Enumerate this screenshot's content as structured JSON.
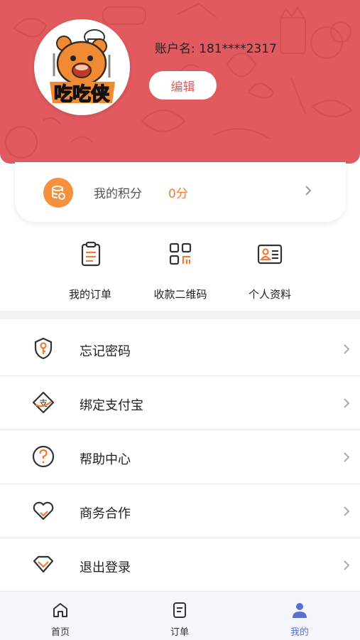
{
  "profile": {
    "account_label": "账户名:",
    "account_value": "181****2317",
    "edit_label": "编辑",
    "avatar_logo_text": "吃吃侠"
  },
  "points": {
    "label": "我的积分",
    "value": "0分"
  },
  "shortcuts": [
    {
      "label": "我的订单",
      "icon": "order-icon"
    },
    {
      "label": "收款二维码",
      "icon": "qr-code-icon"
    },
    {
      "label": "个人资料",
      "icon": "profile-card-icon"
    }
  ],
  "menu": [
    {
      "label": "忘记密码",
      "icon": "shield-key-icon"
    },
    {
      "label": "绑定支付宝",
      "icon": "alipay-icon"
    },
    {
      "label": "帮助中心",
      "icon": "help-icon"
    },
    {
      "label": "商务合作",
      "icon": "handshake-heart-icon"
    },
    {
      "label": "退出登录",
      "icon": "logout-diamond-icon"
    }
  ],
  "tabbar": [
    {
      "label": "首页",
      "icon": "home-icon",
      "active": false
    },
    {
      "label": "订单",
      "icon": "order-doc-icon",
      "active": false
    },
    {
      "label": "我的",
      "icon": "user-icon",
      "active": true
    }
  ],
  "colors": {
    "header_bg": "#e05a5f",
    "accent_orange": "#f07b3a",
    "tab_active": "#5a6fd6",
    "icon_stroke": "#333333"
  }
}
